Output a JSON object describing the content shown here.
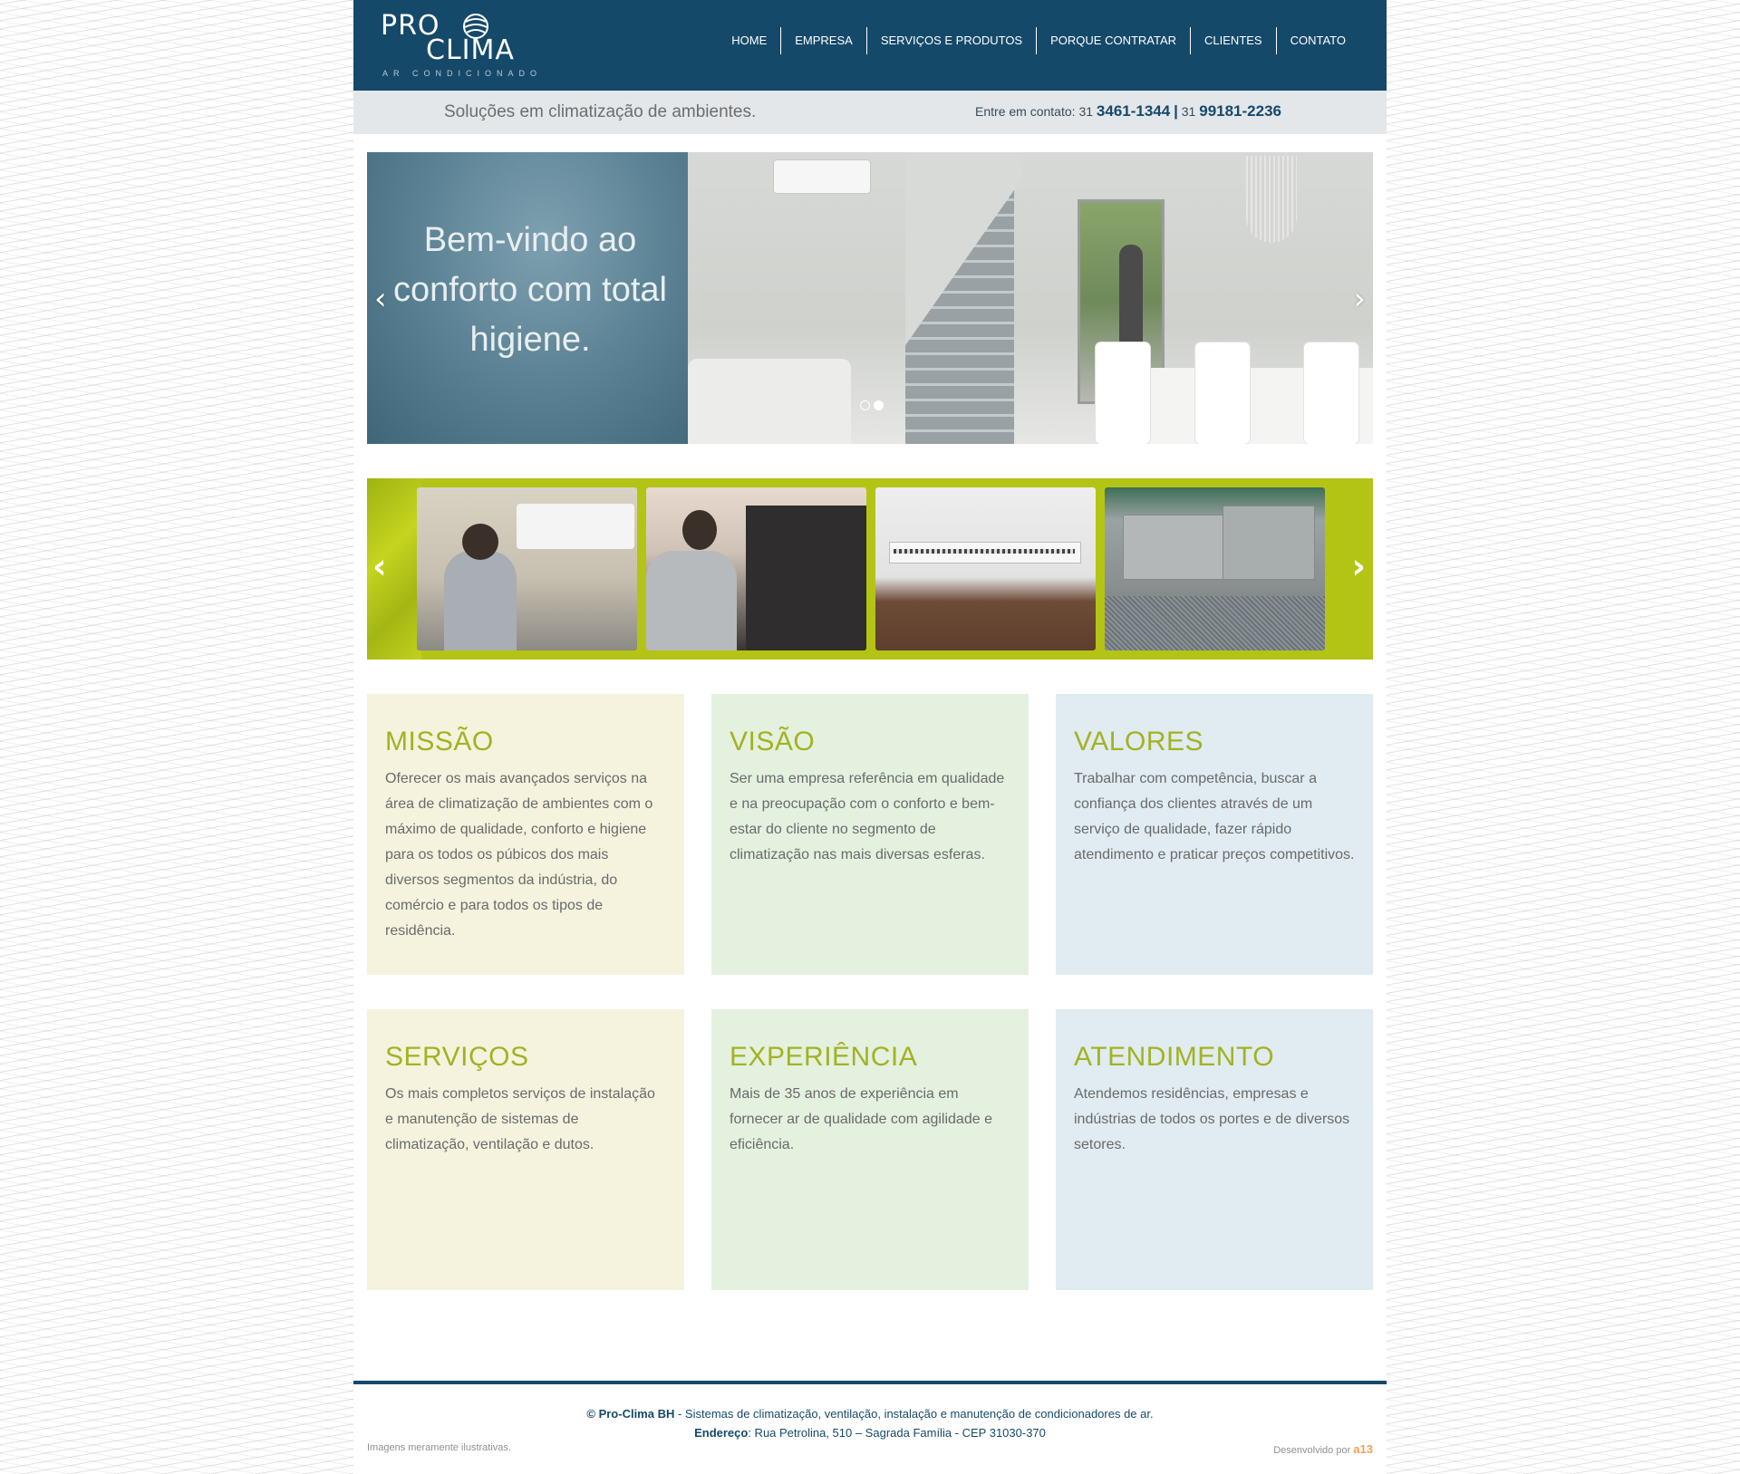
{
  "header": {
    "logo": {
      "line1": "PRO",
      "line2": "CLIMA",
      "tagline": "AR CONDICIONADO"
    },
    "nav": [
      {
        "label": "HOME"
      },
      {
        "label": "EMPRESA"
      },
      {
        "label": "SERVIÇOS E PRODUTOS"
      },
      {
        "label": "PORQUE CONTRATAR"
      },
      {
        "label": "CLIENTES"
      },
      {
        "label": "CONTATO"
      }
    ]
  },
  "infobar": {
    "tagline": "Soluções em climatização de ambientes.",
    "contact_label": "Entre em contato:",
    "phone1_ddd": "31",
    "phone1": "3461-1344",
    "separator": "|",
    "phone2_ddd": "31",
    "phone2": "99181-2236"
  },
  "hero": {
    "text": "Bem-vindo ao conforto com total higiene.",
    "prev_icon": "chevron-left-icon",
    "next_icon": "chevron-right-icon",
    "slides_count": 2,
    "active_slide": 2
  },
  "gallery": {
    "prev_icon": "chevron-left-icon",
    "next_icon": "chevron-right-icon"
  },
  "cards": [
    {
      "title": "MISSÃO",
      "body": "Oferecer os mais avançados serviços na área de climatização de ambientes com o máximo de qualidade, conforto e higiene para os todos os púbicos dos mais diversos segmentos da indústria, do comércio e para todos os tipos de residência."
    },
    {
      "title": "VISÃO",
      "body": "Ser uma empresa referência em qualidade e na preocupação com o conforto e bem-estar do cliente no segmento de climatização nas mais diversas esferas."
    },
    {
      "title": "VALORES",
      "body": "Trabalhar com competência, buscar a confiança dos clientes através de um serviço de qualidade, fazer rápido atendimento e praticar preços competitivos."
    },
    {
      "title": "SERVIÇOS",
      "body": "Os mais completos serviços de instalação e manutenção de sistemas de climatização, ventilação e dutos."
    },
    {
      "title": "EXPERIÊNCIA",
      "body": "Mais de 35 anos de experiência em fornecer ar de qualidade com agilidade e eficiência."
    },
    {
      "title": "ATENDIMENTO",
      "body": "Atendemos residências, empresas e indústrias de todos os portes e de diversos setores."
    }
  ],
  "footer": {
    "copyright_brand": "© Pro-Clima BH",
    "copyright_text": " - Sistemas de climatização, ventilação, instalação e manutenção de condicionadores de ar.",
    "address_label": "Endereço",
    "address_text": ": Rua Petrolina, 510 – Sagrada Família - CEP 31030-370",
    "note": "Imagens meramente ilustrativas.",
    "dev_label": "Desenvolvido por",
    "dev_brand": "a13"
  },
  "colors": {
    "header_bg": "#15496a",
    "accent_green": "#b4c414",
    "card_title": "#a3b221",
    "card_yellow": "#f5f3de",
    "card_green": "#e4f1df",
    "card_blue": "#e0ecf1"
  }
}
